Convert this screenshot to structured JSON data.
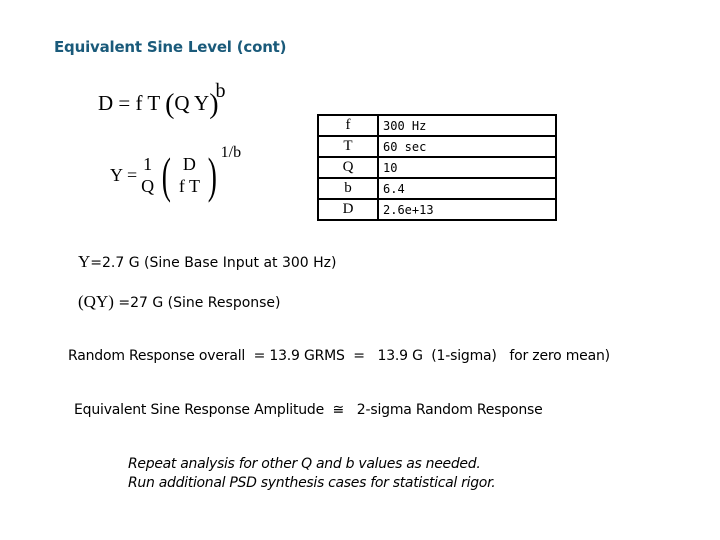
{
  "title": "Equivalent Sine Level (cont)",
  "equations": {
    "damage": {
      "lhs": "D",
      "eq": "=",
      "rhs": "f T",
      "lparen": "(",
      "inner": "Q Y",
      "rparen": ")",
      "exponent": "b"
    },
    "amplitude": {
      "lhs": "Y",
      "eq": "=",
      "frac1_num": "1",
      "frac1_den": "Q",
      "lparen": "(",
      "frac2_num": "D",
      "frac2_den": "f T",
      "rparen": ")",
      "exponent": "1/b"
    }
  },
  "parameters": [
    {
      "symbol": "f",
      "value": "300 Hz"
    },
    {
      "symbol": "T",
      "value": "60 sec"
    },
    {
      "symbol": "Q",
      "value": "10"
    },
    {
      "symbol": "b",
      "value": "6.4"
    },
    {
      "symbol": "D",
      "value": "2.6e+13"
    }
  ],
  "results": {
    "base_input": {
      "symbol": "Y",
      "text": "=2.7 G   (Sine Base Input at 300 Hz)"
    },
    "response": {
      "symbol": "(QY)",
      "text": " =27 G   (Sine Response)"
    },
    "random": "Random Response overall  = 13.9 GRMS  =   13.9 G  (1-sigma)   for zero mean)",
    "equivalence": "Equivalent Sine Response Amplitude  ≅   2-sigma Random Response"
  },
  "notes": [
    "Repeat analysis for other Q and b values as needed.",
    "Run additional PSD synthesis cases for statistical rigor."
  ]
}
